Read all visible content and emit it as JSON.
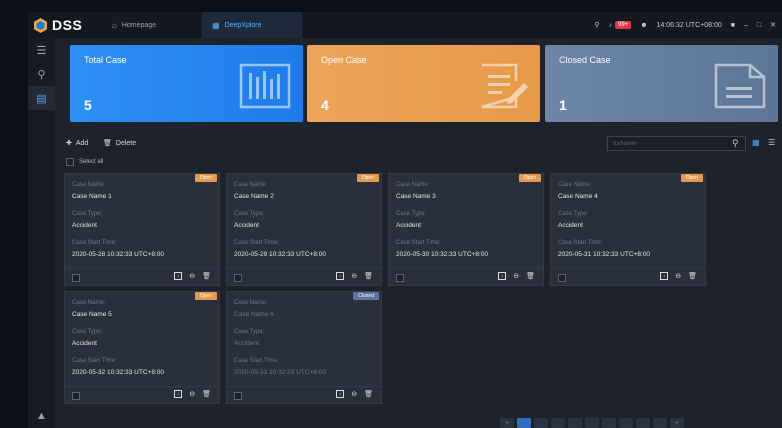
{
  "app": {
    "name": "DSS",
    "time": "14:06:32 UTC+08:00",
    "alarm_count": "99+"
  },
  "tabs": [
    {
      "label": "Homepage"
    },
    {
      "label": "DeepXplore"
    }
  ],
  "summary": [
    {
      "label": "Total Case",
      "count": "5"
    },
    {
      "label": "Open Case",
      "count": "4"
    },
    {
      "label": "Closed Case",
      "count": "1"
    }
  ],
  "toolbar": {
    "add": "Add",
    "delete": "Delete",
    "select_all": "Select all",
    "search_placeholder": "ID/Name"
  },
  "field_labels": {
    "name": "Case Name:",
    "type": "Case Type:",
    "start": "Case Start Time:"
  },
  "cases": [
    {
      "status": "Open",
      "name": "Case Name 1",
      "type": "Accident",
      "start": "2020-05-28 10:32:33 UTC+8:00"
    },
    {
      "status": "Open",
      "name": "Case Name 2",
      "type": "Accident",
      "start": "2020-05-29 10:32:33 UTC+8:00"
    },
    {
      "status": "Open",
      "name": "Case Name 3",
      "type": "Accident",
      "start": "2020-05-30 10:32:33 UTC+8:00"
    },
    {
      "status": "Open",
      "name": "Case Name 4",
      "type": "Accident",
      "start": "2020-05-31 10:32:33 UTC+8:00"
    },
    {
      "status": "Open",
      "name": "Case Name 5",
      "type": "Accident",
      "start": "2020-05-32 10:32:33 UTC+8:00"
    },
    {
      "status": "Closed",
      "name": "Case Name 6",
      "type": "Accident",
      "start": "2020-05-33 10:32:33 UTC+8:00"
    }
  ],
  "colors": {
    "accent": "#2e8ff4",
    "open": "#e69a48",
    "closed": "#5c7698"
  }
}
